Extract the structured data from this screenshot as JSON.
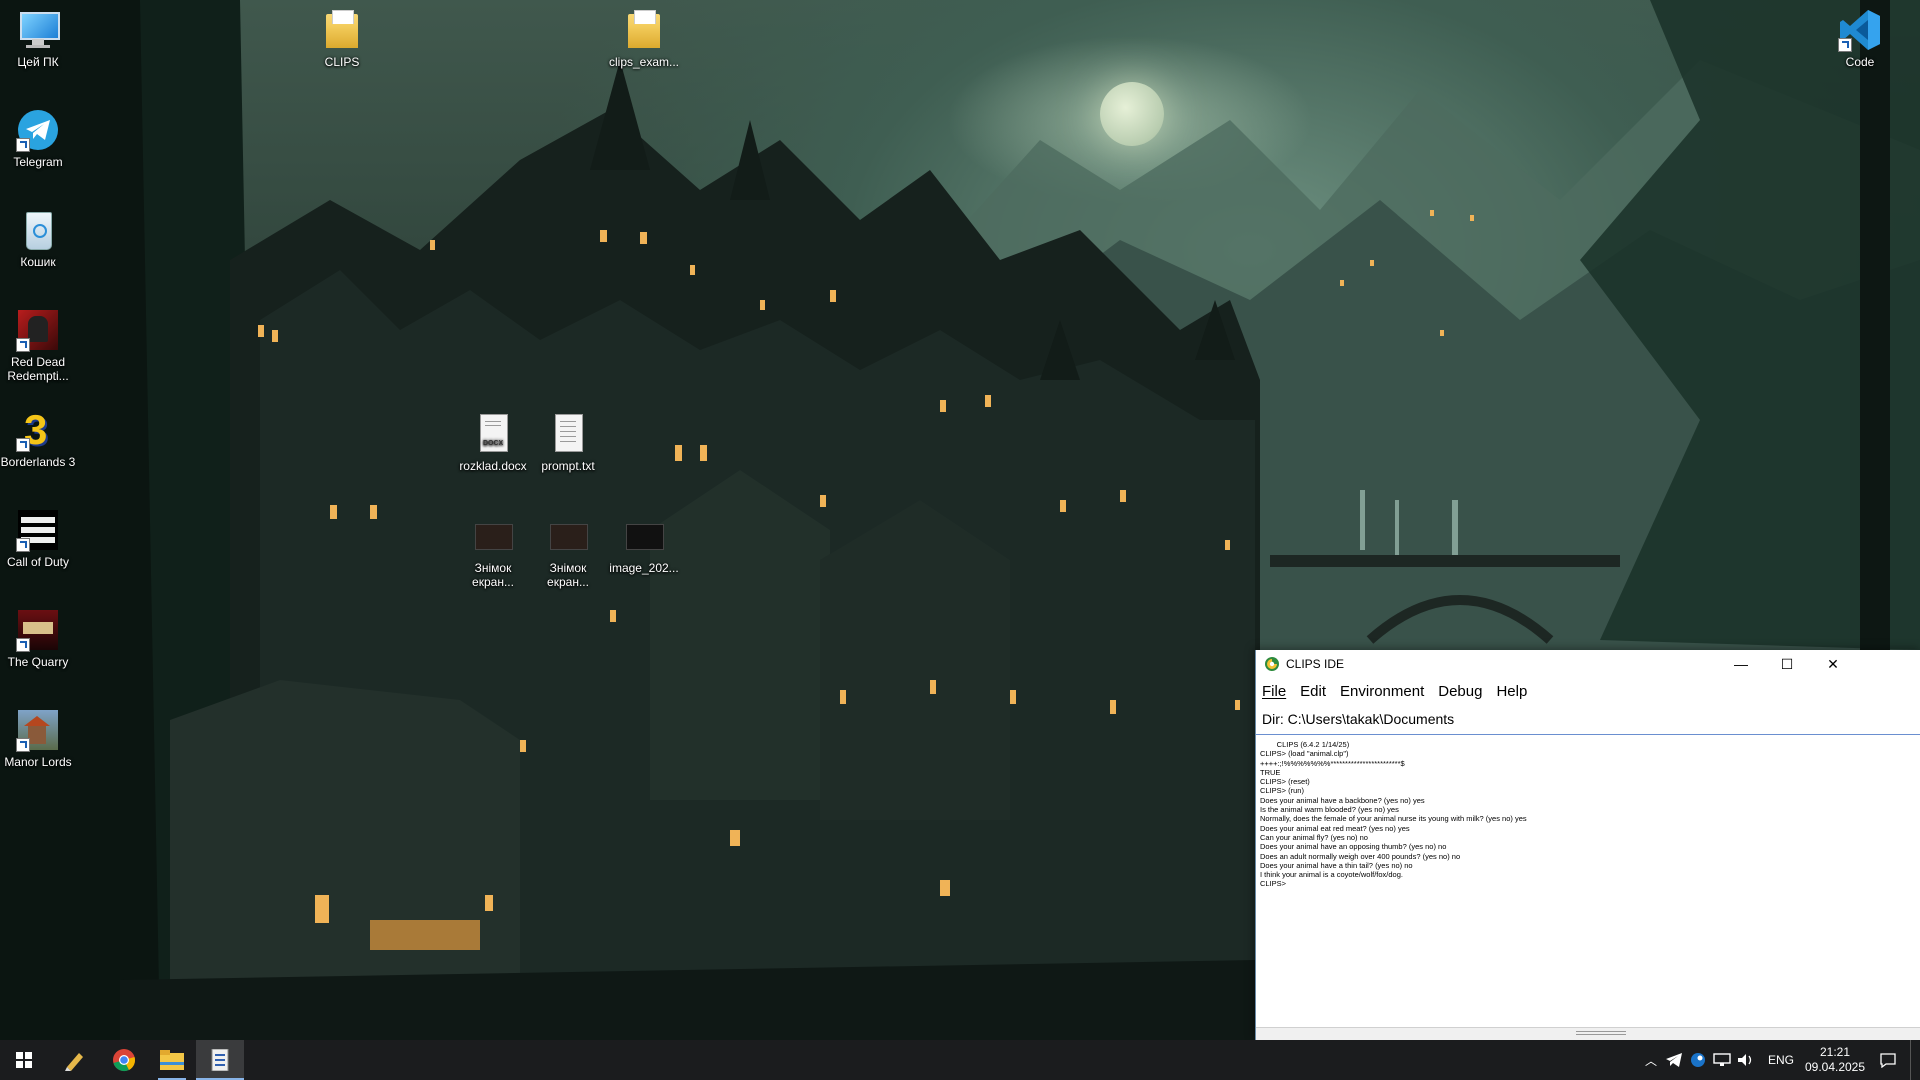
{
  "desktop": {
    "left_icons": [
      {
        "label": "Цей ПК",
        "icon": "computer-icon"
      },
      {
        "label": "Telegram",
        "icon": "telegram-icon"
      },
      {
        "label": "Кошик",
        "icon": "recycle-bin-icon"
      },
      {
        "label": "Red Dead Redempti...",
        "icon": "red-dead-redemption-icon"
      },
      {
        "label": "Borderlands 3",
        "icon": "borderlands-icon"
      },
      {
        "label": "Call of Duty",
        "icon": "call-of-duty-icon"
      },
      {
        "label": "The Quarry",
        "icon": "the-quarry-icon"
      },
      {
        "label": "Manor Lords",
        "icon": "manor-lords-icon"
      }
    ],
    "folders": [
      {
        "label": "CLIPS",
        "icon": "folder-icon"
      },
      {
        "label": "clips_exam...",
        "icon": "folder-icon"
      }
    ],
    "files": [
      {
        "label": "rozklad.docx",
        "icon": "docx-file-icon",
        "badge": "DOCX"
      },
      {
        "label": "prompt.txt",
        "icon": "txt-file-icon"
      },
      {
        "label": "Знімок екран...",
        "icon": "image-file-icon"
      },
      {
        "label": "Знімок екран...",
        "icon": "image-file-icon"
      },
      {
        "label": "image_202...",
        "icon": "image-file-icon"
      }
    ],
    "right_icons": [
      {
        "label": "Code",
        "icon": "vscode-icon"
      }
    ]
  },
  "clips_window": {
    "title": "CLIPS IDE",
    "controls": {
      "minimize": "—",
      "maximize": "☐",
      "close": "✕"
    },
    "menu": [
      "File",
      "Edit",
      "Environment",
      "Debug",
      "Help"
    ],
    "dir": "Dir: C:\\Users\\takak\\Documents",
    "console_lines": [
      "        CLIPS (6.4.2 1/14/25)",
      "CLIPS> (load \"animal.clp\")",
      "++++:;!%%%%%%%************************$",
      "TRUE",
      "CLIPS> (reset)",
      "CLIPS> (run)",
      "Does your animal have a backbone? (yes no) yes",
      "Is the animal warm blooded? (yes no) yes",
      "Normally, does the female of your animal nurse its young with milk? (yes no) yes",
      "Does your animal eat red meat? (yes no) yes",
      "Can your animal fly? (yes no) no",
      "Does your animal have an opposing thumb? (yes no) no",
      "Does an adult normally weigh over 400 pounds? (yes no) no",
      "Does your animal have a thin tail? (yes no) no",
      "I think your animal is a coyote/wolf/fox/dog.",
      "CLIPS>"
    ]
  },
  "taskbar": {
    "apps": [
      {
        "name": "start",
        "icon": "windows-start-icon"
      },
      {
        "name": "notepad",
        "icon": "pen-icon"
      },
      {
        "name": "chrome",
        "icon": "chrome-icon"
      },
      {
        "name": "explorer",
        "icon": "file-explorer-icon"
      },
      {
        "name": "clips",
        "icon": "clips-app-icon",
        "active": true
      }
    ],
    "tray": {
      "language": "ENG",
      "time": "21:21",
      "date": "09.04.2025"
    }
  },
  "colors": {
    "taskbar_bg": "#1b1c1e",
    "window_border": "#6b8ba7",
    "dir_underline": "#6a8fd0"
  }
}
